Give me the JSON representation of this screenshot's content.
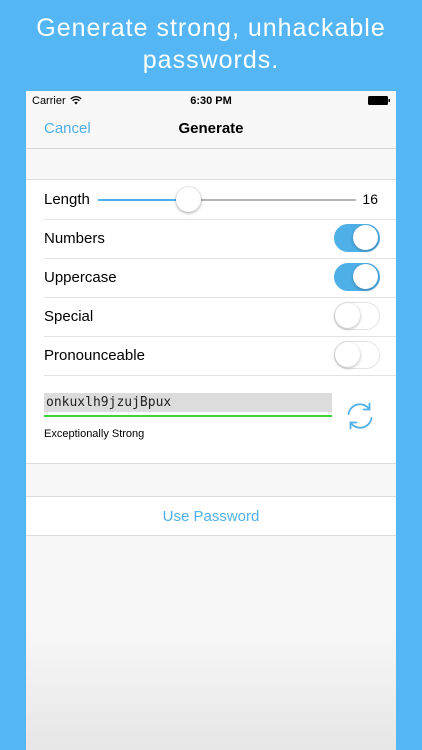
{
  "promo": {
    "line1": "Generate strong, unhackable",
    "line2": "passwords."
  },
  "status_bar": {
    "carrier": "Carrier",
    "time": "6:30 PM",
    "wifi_icon": "wifi-icon",
    "battery_icon": "battery-icon"
  },
  "nav": {
    "cancel": "Cancel",
    "title": "Generate"
  },
  "options": {
    "length": {
      "label": "Length",
      "value": "16",
      "slider_fraction": 0.35
    },
    "numbers": {
      "label": "Numbers",
      "on": true
    },
    "uppercase": {
      "label": "Uppercase",
      "on": true
    },
    "special": {
      "label": "Special",
      "on": false
    },
    "pronounceable": {
      "label": "Pronounceable",
      "on": false
    }
  },
  "password": {
    "value": "onkuxlh9jzujBpux",
    "strength": "Exceptionally Strong",
    "strength_color": "#41d33c",
    "refresh_icon": "refresh-icon"
  },
  "actions": {
    "use_password": "Use Password"
  },
  "colors": {
    "background": "#55b6f5",
    "accent": "#4fb0e8"
  }
}
